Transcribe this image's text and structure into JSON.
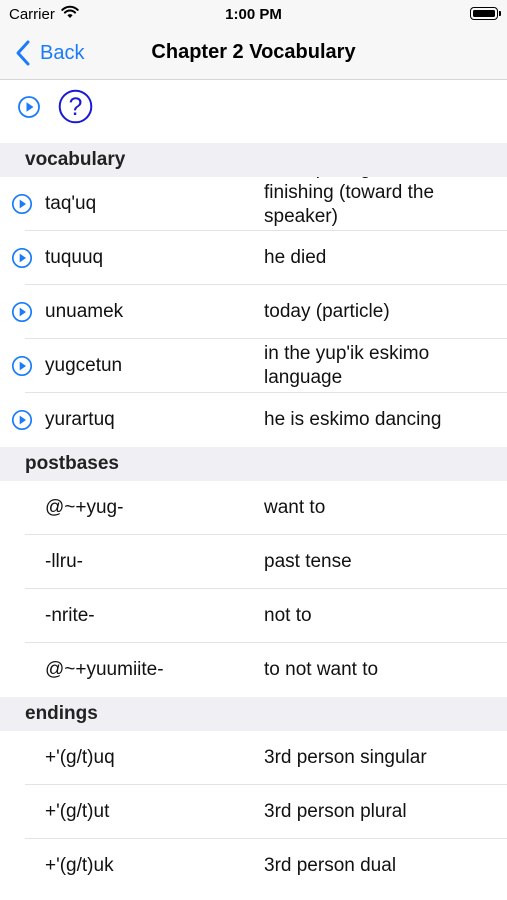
{
  "status_bar": {
    "carrier": "Carrier",
    "time": "1:00 PM",
    "battery_level": 1.0
  },
  "nav": {
    "back_label": "Back",
    "title": "Chapter 2 Vocabulary"
  },
  "toolbar": {
    "help_symbol": "?"
  },
  "colors": {
    "accent": "#1a7cfa",
    "help": "#1a1ad6",
    "section_bg": "#efeff4"
  },
  "icons": {
    "play": "play-circle-icon",
    "help": "question-circle-icon",
    "back": "chevron-left-icon",
    "wifi": "wifi-icon",
    "battery": "battery-icon"
  },
  "sections": [
    {
      "title": "vocabulary",
      "rows": [
        {
          "term": "taq'uq",
          "meaning": "he is quitting, he is finishing (toward the speaker)",
          "has_audio": true
        },
        {
          "term": "tuquuq",
          "meaning": "he died",
          "has_audio": true
        },
        {
          "term": "unuamek",
          "meaning": "today (particle)",
          "has_audio": true
        },
        {
          "term": "yugcetun",
          "meaning": "in the yup'ik eskimo language",
          "has_audio": true
        },
        {
          "term": "yurartuq",
          "meaning": "he is eskimo dancing",
          "has_audio": true
        }
      ]
    },
    {
      "title": "postbases",
      "rows": [
        {
          "term": "@~+yug-",
          "meaning": "want to",
          "has_audio": false
        },
        {
          "term": "-llru-",
          "meaning": "past tense",
          "has_audio": false
        },
        {
          "term": "-nrite-",
          "meaning": "not to",
          "has_audio": false
        },
        {
          "term": "@~+yuumiite-",
          "meaning": "to not want to",
          "has_audio": false
        }
      ]
    },
    {
      "title": "endings",
      "rows": [
        {
          "term": "+'(g/t)uq",
          "meaning": "3rd person singular",
          "has_audio": false
        },
        {
          "term": "+'(g/t)ut",
          "meaning": "3rd person plural",
          "has_audio": false
        },
        {
          "term": "+'(g/t)uk",
          "meaning": "3rd person dual",
          "has_audio": false
        }
      ]
    }
  ]
}
